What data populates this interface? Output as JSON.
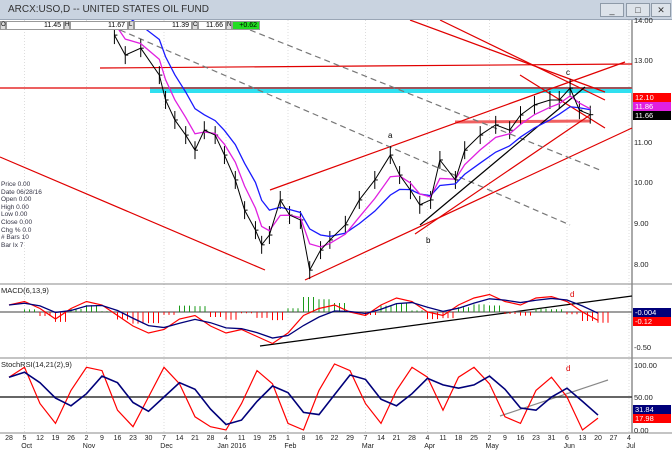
{
  "window": {
    "title": "ARCX:USO,D -- UNITED STATES OIL FUND",
    "min": "_",
    "max": "□",
    "close": "✕"
  },
  "quote": {
    "open_label": "O",
    "open": "11.45",
    "high_label": "H",
    "high": "11.67",
    "low_label": "L",
    "low": "11.39",
    "close_label": "C",
    "close": "11.66",
    "change_label": "N",
    "change": "+0.62"
  },
  "info": [
    "Price  0.00",
    "Date  06/28/16",
    "Open  0.00",
    "High  0.00",
    "Low  0.00",
    "Close  0.00",
    "Chg %  0.0",
    "# Bars  10",
    "Bar Ix  7"
  ],
  "annotations": {
    "a": "a",
    "b": "b",
    "c": "c",
    "d1": "d",
    "d2": "d"
  },
  "axis": {
    "price": [
      "14.00",
      "13.00",
      "11.00",
      "10.00",
      "9.00",
      "8.00"
    ],
    "macd": [
      "-0.50"
    ],
    "stoch": [
      "100.00",
      "50.00",
      "0.00"
    ]
  },
  "tags": {
    "p1": "12.10",
    "p2": "11.86",
    "p3": "11.66",
    "m1": "-0.004",
    "m2": "-0.12",
    "s1": "31.84",
    "s2": "17.98"
  },
  "indicators": {
    "macd": "MACD(6,13,9)",
    "stoch": "StochRSI(14,21(2),9)"
  },
  "colors": {
    "price": "#000000",
    "ma1": "#e020e0",
    "ma2": "#1a1aff",
    "trend": "#e00000",
    "cyan": "#30e0f0",
    "macd": "#ff0000",
    "signal": "#00007a"
  },
  "chart_data": {
    "type": "line",
    "title": "ARCX:USO,D -- UNITED STATES OIL FUND",
    "x_unit": "weeks since Sep 28 2015",
    "x_ticks": [
      {
        "l": "28",
        "w": 0
      },
      {
        "l": "5",
        "w": 1,
        "m": "Oct"
      },
      {
        "l": "12",
        "w": 2
      },
      {
        "l": "19",
        "w": 3
      },
      {
        "l": "26",
        "w": 4
      },
      {
        "l": "2",
        "w": 5,
        "m": "Nov"
      },
      {
        "l": "9",
        "w": 6
      },
      {
        "l": "16",
        "w": 7
      },
      {
        "l": "23",
        "w": 8
      },
      {
        "l": "30",
        "w": 9
      },
      {
        "l": "7",
        "w": 10,
        "m": "Dec"
      },
      {
        "l": "14",
        "w": 11
      },
      {
        "l": "21",
        "w": 12
      },
      {
        "l": "28",
        "w": 13
      },
      {
        "l": "4",
        "w": 14,
        "m": "Jan 2016"
      },
      {
        "l": "11",
        "w": 15
      },
      {
        "l": "19",
        "w": 16
      },
      {
        "l": "25",
        "w": 17
      },
      {
        "l": "1",
        "w": 18,
        "m": "Feb"
      },
      {
        "l": "8",
        "w": 19
      },
      {
        "l": "16",
        "w": 20
      },
      {
        "l": "22",
        "w": 21
      },
      {
        "l": "29",
        "w": 22
      },
      {
        "l": "7",
        "w": 23,
        "m": "Mar"
      },
      {
        "l": "14",
        "w": 24
      },
      {
        "l": "21",
        "w": 25
      },
      {
        "l": "28",
        "w": 26
      },
      {
        "l": "4",
        "w": 27,
        "m": "Apr"
      },
      {
        "l": "11",
        "w": 28
      },
      {
        "l": "18",
        "w": 29
      },
      {
        "l": "25",
        "w": 30
      },
      {
        "l": "2",
        "w": 31,
        "m": "May"
      },
      {
        "l": "9",
        "w": 32
      },
      {
        "l": "16",
        "w": 33
      },
      {
        "l": "23",
        "w": 34
      },
      {
        "l": "31",
        "w": 35
      },
      {
        "l": "6",
        "w": 36,
        "m": "Jun"
      },
      {
        "l": "13",
        "w": 37
      },
      {
        "l": "20",
        "w": 38
      },
      {
        "l": "27",
        "w": 39
      },
      {
        "l": "4",
        "w": 40,
        "m": "Jul"
      }
    ],
    "price": [
      [
        6.8,
        13.61
      ],
      [
        7.5,
        13.12
      ],
      [
        8.5,
        13.29
      ],
      [
        9.7,
        12.63
      ],
      [
        10.1,
        12.02
      ],
      [
        10.7,
        11.53
      ],
      [
        11.4,
        11.16
      ],
      [
        12,
        10.79
      ],
      [
        12.6,
        11.28
      ],
      [
        13.3,
        11.16
      ],
      [
        13.9,
        10.67
      ],
      [
        14.6,
        10.06
      ],
      [
        15.2,
        9.32
      ],
      [
        15.9,
        8.83
      ],
      [
        16.3,
        8.47
      ],
      [
        16.8,
        8.71
      ],
      [
        17.5,
        9.57
      ],
      [
        18.1,
        9.2
      ],
      [
        18.8,
        9.08
      ],
      [
        19.4,
        7.85
      ],
      [
        20.1,
        8.34
      ],
      [
        20.7,
        8.59
      ],
      [
        21.7,
        8.96
      ],
      [
        22.6,
        9.57
      ],
      [
        23.6,
        10.06
      ],
      [
        24.6,
        10.67
      ],
      [
        25.2,
        10.18
      ],
      [
        25.9,
        9.81
      ],
      [
        26.5,
        9.45
      ],
      [
        27.2,
        9.57
      ],
      [
        27.8,
        10.55
      ],
      [
        28.8,
        10.06
      ],
      [
        29.4,
        10.79
      ],
      [
        30.4,
        11.16
      ],
      [
        31.4,
        11.41
      ],
      [
        32.3,
        11.28
      ],
      [
        33,
        11.65
      ],
      [
        33.9,
        11.9
      ],
      [
        34.9,
        12.02
      ],
      [
        35.5,
        12.02
      ],
      [
        36.2,
        12.31
      ],
      [
        36.8,
        11.77
      ],
      [
        37.5,
        11.66
      ]
    ],
    "price_ylim": [
      7.5,
      14.2
    ],
    "macd": [
      0.1,
      0.15,
      0.05,
      -0.1,
      0.05,
      0.15,
      0.1,
      -0.05,
      -0.2,
      -0.3,
      -0.25,
      -0.1,
      -0.05,
      -0.2,
      -0.3,
      -0.25,
      -0.35,
      -0.45,
      -0.3,
      -0.05,
      0.05,
      0.1,
      0.0,
      -0.05,
      0.1,
      0.2,
      0.15,
      0.0,
      -0.05,
      0.1,
      0.2,
      0.25,
      0.15,
      0.1,
      0.2,
      0.22,
      0.15,
      0.0,
      -0.12
    ],
    "stoch": [
      80,
      95,
      40,
      10,
      60,
      95,
      90,
      30,
      5,
      50,
      95,
      70,
      20,
      5,
      0,
      40,
      90,
      70,
      10,
      0,
      60,
      100,
      90,
      40,
      10,
      60,
      95,
      80,
      30,
      80,
      95,
      70,
      20,
      10,
      60,
      80,
      50,
      0,
      18
    ]
  }
}
